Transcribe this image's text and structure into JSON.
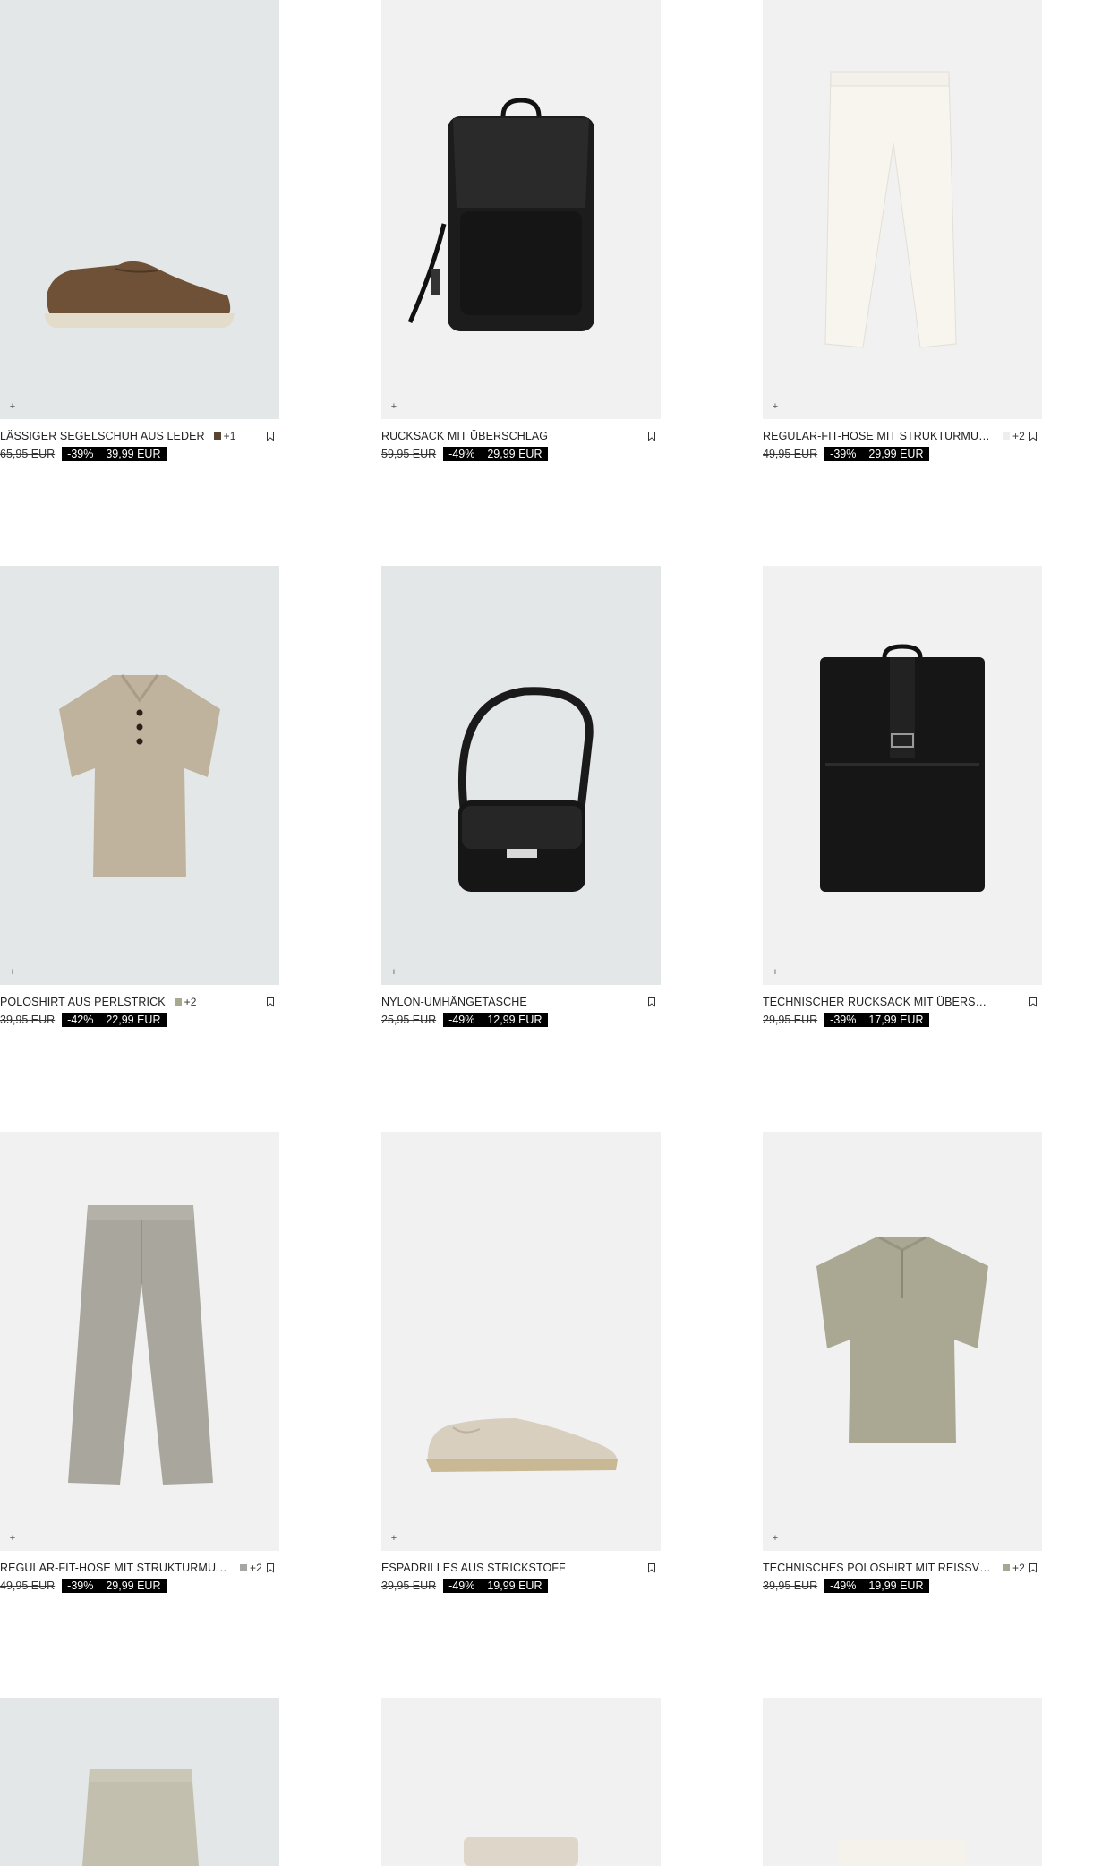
{
  "colors": {
    "bg_cool": "#e4e7e8",
    "bg_warm": "#f1f1f1",
    "price_tag_bg": "#000000",
    "price_tag_text": "#ffffff"
  },
  "icons": {
    "add": "plus-icon",
    "save": "bookmark-icon"
  },
  "products": [
    {
      "name": "LÄSSIGER SEGELSCHUH AUS LEDER",
      "swatch": "#5a4533",
      "colors_more": "+1",
      "old_price": "65,95 EUR",
      "discount": "-39%",
      "price": "39,99 EUR"
    },
    {
      "name": "RUCKSACK MIT ÜBERSCHLAG",
      "swatch": "",
      "colors_more": "",
      "old_price": "59,95 EUR",
      "discount": "-49%",
      "price": "29,99 EUR"
    },
    {
      "name": "REGULAR-FIT-HOSE MIT STRUKTURMUS...",
      "swatch": "#eeeeee",
      "colors_more": "+2",
      "old_price": "49,95 EUR",
      "discount": "-39%",
      "price": "29,99 EUR"
    },
    {
      "name": "POLOSHIRT AUS PERLSTRICK",
      "swatch": "#a9a78f",
      "colors_more": "+2",
      "old_price": "39,95 EUR",
      "discount": "-42%",
      "price": "22,99 EUR"
    },
    {
      "name": "NYLON-UMHÄNGETASCHE",
      "swatch": "",
      "colors_more": "",
      "old_price": "25,95 EUR",
      "discount": "-49%",
      "price": "12,99 EUR"
    },
    {
      "name": "TECHNISCHER RUCKSACK MIT ÜBERSCHLAG",
      "swatch": "",
      "colors_more": "",
      "old_price": "29,95 EUR",
      "discount": "-39%",
      "price": "17,99 EUR"
    },
    {
      "name": "REGULAR-FIT-HOSE MIT STRUKTURMUS...",
      "swatch": "#a6a6a2",
      "colors_more": "+2",
      "old_price": "49,95 EUR",
      "discount": "-39%",
      "price": "29,99 EUR"
    },
    {
      "name": "ESPADRILLES AUS STRICKSTOFF",
      "swatch": "",
      "colors_more": "",
      "old_price": "39,95 EUR",
      "discount": "-49%",
      "price": "19,99 EUR"
    },
    {
      "name": "TECHNISCHES POLOSHIRT MIT REISSVE...",
      "swatch": "#a6a895",
      "colors_more": "+2",
      "old_price": "39,95 EUR",
      "discount": "-49%",
      "price": "19,99 EUR"
    }
  ]
}
